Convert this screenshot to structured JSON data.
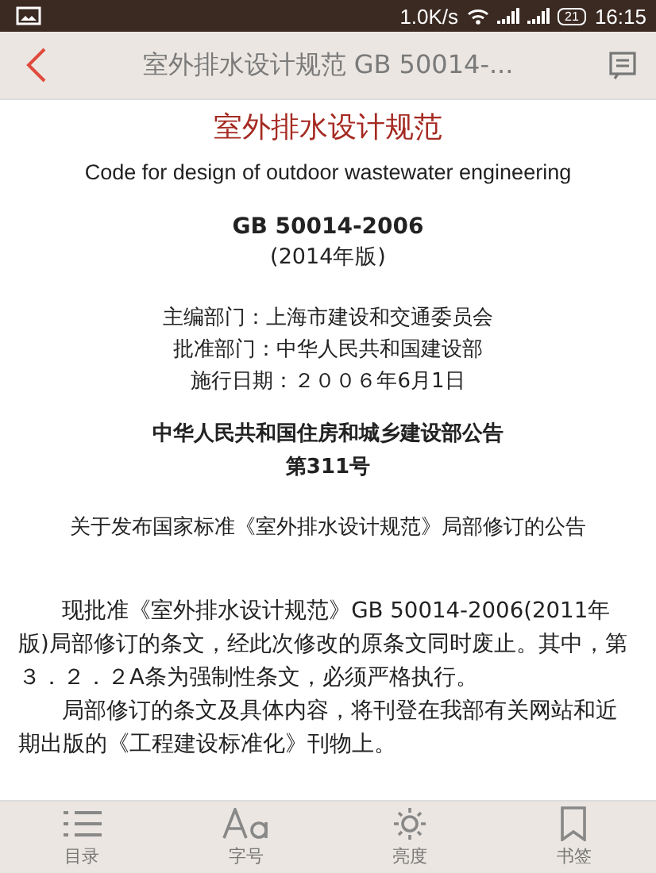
{
  "status_bar": {
    "speed": "1.0K/s",
    "battery": "21",
    "time": "16:15"
  },
  "header": {
    "title": "室外排水设计规范 GB 50014-..."
  },
  "document": {
    "title": "室外排水设计规范",
    "subtitle": "Code for design of outdoor wastewater engineering",
    "code": "GB 50014-2006",
    "edition": "(2014年版)",
    "info": [
      "主编部门：上海市建设和交通委员会",
      "批准部门：中华人民共和国建设部",
      "施行日期：２００６年6月1日"
    ],
    "notice_title": [
      "中华人民共和国住房和城乡建设部公告",
      "第311号"
    ],
    "notice_subject": "关于发布国家标准《室外排水设计规范》局部修订的公告",
    "paragraphs": [
      "现批准《室外排水设计规范》GB 50014-2006(2011年版)局部修订的条文，经此次修改的原条文同时废止。其中，第３．２．２A条为强制性条文，必须严格执行。",
      "局部修订的条文及具体内容，将刊登在我部有关网站和近期出版的《工程建设标准化》刊物上。"
    ]
  },
  "toolbar": [
    {
      "kind": "contents",
      "label": "目录"
    },
    {
      "kind": "font",
      "label": "字号"
    },
    {
      "kind": "brightness",
      "label": "亮度"
    },
    {
      "kind": "bookmark",
      "label": "书签"
    }
  ]
}
